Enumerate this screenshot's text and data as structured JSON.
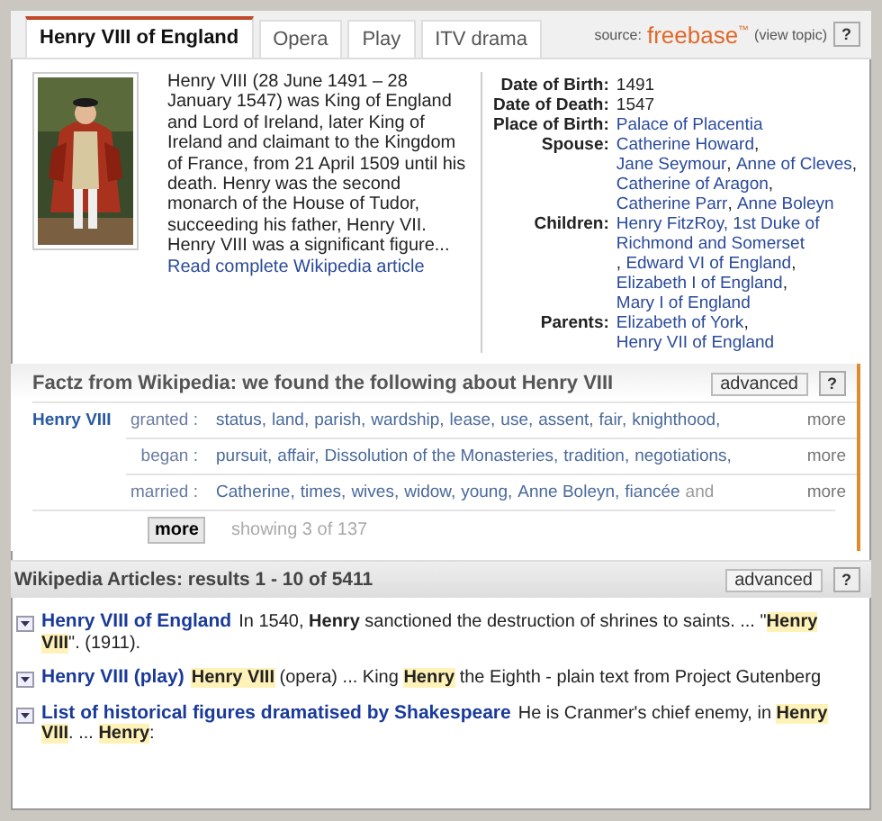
{
  "tabs": [
    {
      "label": "Henry VIII of England",
      "selected": true
    },
    {
      "label": "Opera",
      "selected": false
    },
    {
      "label": "Play",
      "selected": false
    },
    {
      "label": "ITV drama",
      "selected": false
    }
  ],
  "source": {
    "label": "source:",
    "brand": "freebase",
    "brand_mark": "™",
    "link": "(view topic)",
    "help": "?"
  },
  "summary": {
    "text": "Henry VIII (28 June 1491 – 28 January 1547) was King of England and Lord of Ireland, later King of Ireland and claimant to the Kingdom of France, from 21 April 1509 until his death. Henry was the second monarch of the House of Tudor, succeeding his father, Henry VII. Henry VIII was a significant figure... ",
    "link": "Read complete Wikipedia article"
  },
  "facts": {
    "separator": ", ",
    "rows": [
      {
        "label": "Date of Birth:",
        "kind": "text",
        "values": [
          "1491"
        ]
      },
      {
        "label": "Date of Death:",
        "kind": "text",
        "values": [
          "1547"
        ]
      },
      {
        "label": "Place of Birth:",
        "kind": "link",
        "values": [
          "Palace of Placentia"
        ]
      },
      {
        "label": "Spouse:",
        "kind": "link",
        "values": [
          "Catherine Howard",
          "Jane Seymour",
          "Anne of Cleves",
          "Catherine of Aragon",
          "Catherine Parr",
          "Anne Boleyn"
        ]
      },
      {
        "label": "Children:",
        "kind": "link",
        "values": [
          "Henry FitzRoy, 1st Duke of Richmond and Somerset",
          "Edward VI of England",
          "Elizabeth I of England",
          "Mary I of England"
        ]
      },
      {
        "label": "Parents:",
        "kind": "link",
        "values": [
          "Elizabeth of York",
          "Henry VII of England"
        ]
      }
    ]
  },
  "factz": {
    "title": "Factz from Wikipedia: we found the following about **Henry VIII**",
    "advanced": "advanced",
    "help": "?",
    "subject": "Henry VIII",
    "rows": [
      {
        "verb": "granted :",
        "terms": [
          "status,",
          "land,",
          "parish,",
          "wardship,",
          "lease,",
          "use,",
          "assent,",
          "fair,",
          "knighthood,"
        ],
        "more": "more"
      },
      {
        "verb": "began :",
        "terms": [
          "pursuit,",
          "affair,",
          "Dissolution of the Monasteries,",
          "tradition,",
          "negotiations,"
        ],
        "more": "more"
      },
      {
        "verb": "married :",
        "terms": [
          "Catherine,",
          "times,",
          "wives,",
          "widow,",
          "young,",
          "Anne Boleyn,",
          "fiancée"
        ],
        "trailing": "and",
        "more": "more"
      }
    ],
    "more_button": "more",
    "showing": "showing 3 of 137"
  },
  "articles": {
    "header": "Wikipedia Articles: results 1 - 10 of 5411",
    "advanced": "advanced",
    "help": "?",
    "results": [
      {
        "title": "Henry VIII of England",
        "snippet": [
          {
            "kind": "plain",
            "text": "In 1540, "
          },
          {
            "kind": "bold",
            "text": "Henry"
          },
          {
            "kind": "plain",
            "text": " sanctioned the destruction of shrines to saints. ... \""
          },
          {
            "kind": "mark",
            "text": "Henry VIII"
          },
          {
            "kind": "plain",
            "text": "\". (1911)."
          }
        ]
      },
      {
        "title": "Henry VIII (play)",
        "snippet": [
          {
            "kind": "mark",
            "text": "Henry VIII"
          },
          {
            "kind": "plain",
            "text": " (opera) ... King "
          },
          {
            "kind": "mark",
            "text": "Henry"
          },
          {
            "kind": "plain",
            "text": " the Eighth - plain text from Project Gutenberg"
          }
        ]
      },
      {
        "title": "List of historical figures dramatised by Shakespeare",
        "snippet": [
          {
            "kind": "plain",
            "text": "He is Cranmer's chief enemy, in "
          },
          {
            "kind": "mark",
            "text": "Henry VIII"
          },
          {
            "kind": "plain",
            "text": ". ... "
          },
          {
            "kind": "mark",
            "text": "Henry"
          },
          {
            "kind": "plain",
            "text": ":"
          }
        ]
      }
    ]
  }
}
